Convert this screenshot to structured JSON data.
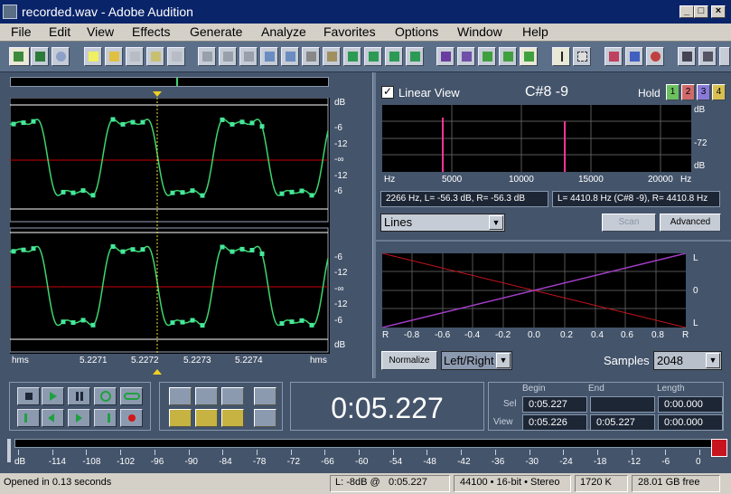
{
  "window": {
    "title": "recorded.wav - Adobe Audition"
  },
  "menu": [
    "File",
    "Edit",
    "View",
    "Effects",
    "Generate",
    "Analyze",
    "Favorites",
    "Options",
    "Window",
    "Help"
  ],
  "wave": {
    "db_ticks_top": [
      "dB",
      "-6",
      "-12",
      "-∞",
      "-12",
      "-6"
    ],
    "db_ticks_bottom": [
      "-6",
      "-12",
      "-∞",
      "-12",
      "-6",
      "dB"
    ],
    "time_ruler": [
      "hms",
      "5.2271",
      "5.2272",
      "5.2273",
      "5.2274",
      "hms"
    ]
  },
  "freq": {
    "linear_label": "Linear View",
    "note": "C#8 -9",
    "hold_label": "Hold",
    "hold_buttons": [
      "1",
      "2",
      "3",
      "4"
    ],
    "db_labels": [
      "dB",
      "-72",
      "dB"
    ],
    "x_labels": [
      "Hz",
      "5000",
      "10000",
      "15000",
      "20000",
      "Hz"
    ],
    "info_left": "2266 Hz, L= -56.3 dB, R= -56.3 dB",
    "info_right": "L= 4410.8 Hz (C#8 -9), R= 4410.8 Hz",
    "mode": "Lines",
    "scan_label": "Scan",
    "advanced_label": "Advanced"
  },
  "phase": {
    "y_labels": [
      "L",
      "0",
      "L"
    ],
    "x_labels": [
      "R",
      "-0.8",
      "-0.6",
      "-0.4",
      "-0.2",
      "0.0",
      "0.2",
      "0.4",
      "0.6",
      "0.8",
      "R"
    ],
    "normalize_label": "Normalize",
    "channel": "Left/Right",
    "samples_label": "Samples",
    "samples": "2048"
  },
  "time_display": "0:05.227",
  "selview": {
    "headers": [
      "Begin",
      "End",
      "Length"
    ],
    "sel_label": "Sel",
    "view_label": "View",
    "sel": [
      "0:05.227",
      "",
      "0:00.000"
    ],
    "view": [
      "0:05.226",
      "0:05.227",
      "0:00.000"
    ]
  },
  "meter": {
    "labels": [
      "dB",
      "-114",
      "-108",
      "-102",
      "-96",
      "-90",
      "-84",
      "-78",
      "-72",
      "-66",
      "-60",
      "-54",
      "-48",
      "-42",
      "-36",
      "-30",
      "-24",
      "-18",
      "-12",
      "-6",
      "0"
    ]
  },
  "status": {
    "opened": "Opened in 0.13 seconds",
    "level": "L: -8dB @",
    "level_time": "0:05.227",
    "format": "44100 • 16-bit • Stereo",
    "size": "1720 K",
    "free": "28.01 GB free"
  },
  "colors": {
    "waveform": "#3dd66c",
    "nodes": "#45e89c",
    "phase_red": "#c8141e",
    "phase_purple": "#a03ec8",
    "peaks": "#ff3399"
  }
}
